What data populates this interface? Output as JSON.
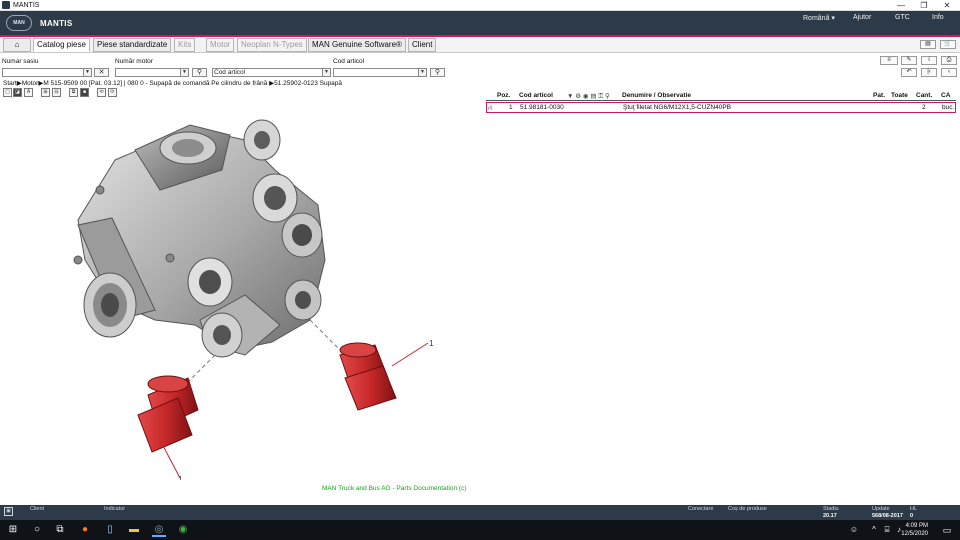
{
  "window": {
    "title": "MANTIS",
    "minimize": "—",
    "maximize": "❐",
    "close": "✕"
  },
  "header": {
    "logo": "MAN",
    "app_name": "MANTIS",
    "language": "Română ▾",
    "help": "Ajutor",
    "gtc": "GTC",
    "info": "Info"
  },
  "tabs": [
    {
      "label": "⌂"
    },
    {
      "label": "Catalog piese"
    },
    {
      "label": "Piese standardizate"
    },
    {
      "label": "Kits"
    },
    {
      "label": "Motor"
    },
    {
      "label": "Neoplan N-Types"
    },
    {
      "label": "MAN Genuine Software®"
    },
    {
      "label": "Client"
    }
  ],
  "search": {
    "chassis_label": "Numar sasiu",
    "engine_label": "Număr motor",
    "article_label": "Cod articol",
    "article_placeholder": "Cod articol",
    "clear": "✕",
    "find": "⚲"
  },
  "breadcrumb": "Start▶Motor▶M 515-9509 00  [Pat. 03.12]  | 080 0 - Supapă de comandă Pe cilindru de frână ▶51.25902-0123  Supapă",
  "table": {
    "columns": [
      "Poz.",
      "Cod articol",
      "Denumire / Observatie",
      "Pat.",
      "Toate",
      "Cant.",
      "CA"
    ],
    "rows": [
      {
        "pos": "1",
        "code": "51.98181-0030",
        "name": "Ştuţ filetat NG6/M12X1,5-CUZN40PB",
        "pat": "",
        "all": "",
        "qty": "2",
        "unit": "buc."
      }
    ]
  },
  "drawing": {
    "callouts": [
      "1",
      "1"
    ]
  },
  "copyright": "MAN Truck and Bus AG - Parts Documentation (c)",
  "status": {
    "client_label": "Client",
    "indicator_label": "Indicator",
    "connection_label": "Conectare",
    "cart_label": "Coș de produse",
    "stadiu_label": "Stadiu",
    "stadiu_value": "20.17",
    "update_label": "Update",
    "update_value": "568/08-2017",
    "hl_label": "HL",
    "hl_value": "0"
  },
  "taskbar": {
    "time": "4:09 PM",
    "date": "12/5/2020"
  },
  "colors": {
    "header": "#2d3a47",
    "accent": "#c41e5c",
    "part_red": "#c8282a",
    "copyright_green": "#1aa31a"
  }
}
